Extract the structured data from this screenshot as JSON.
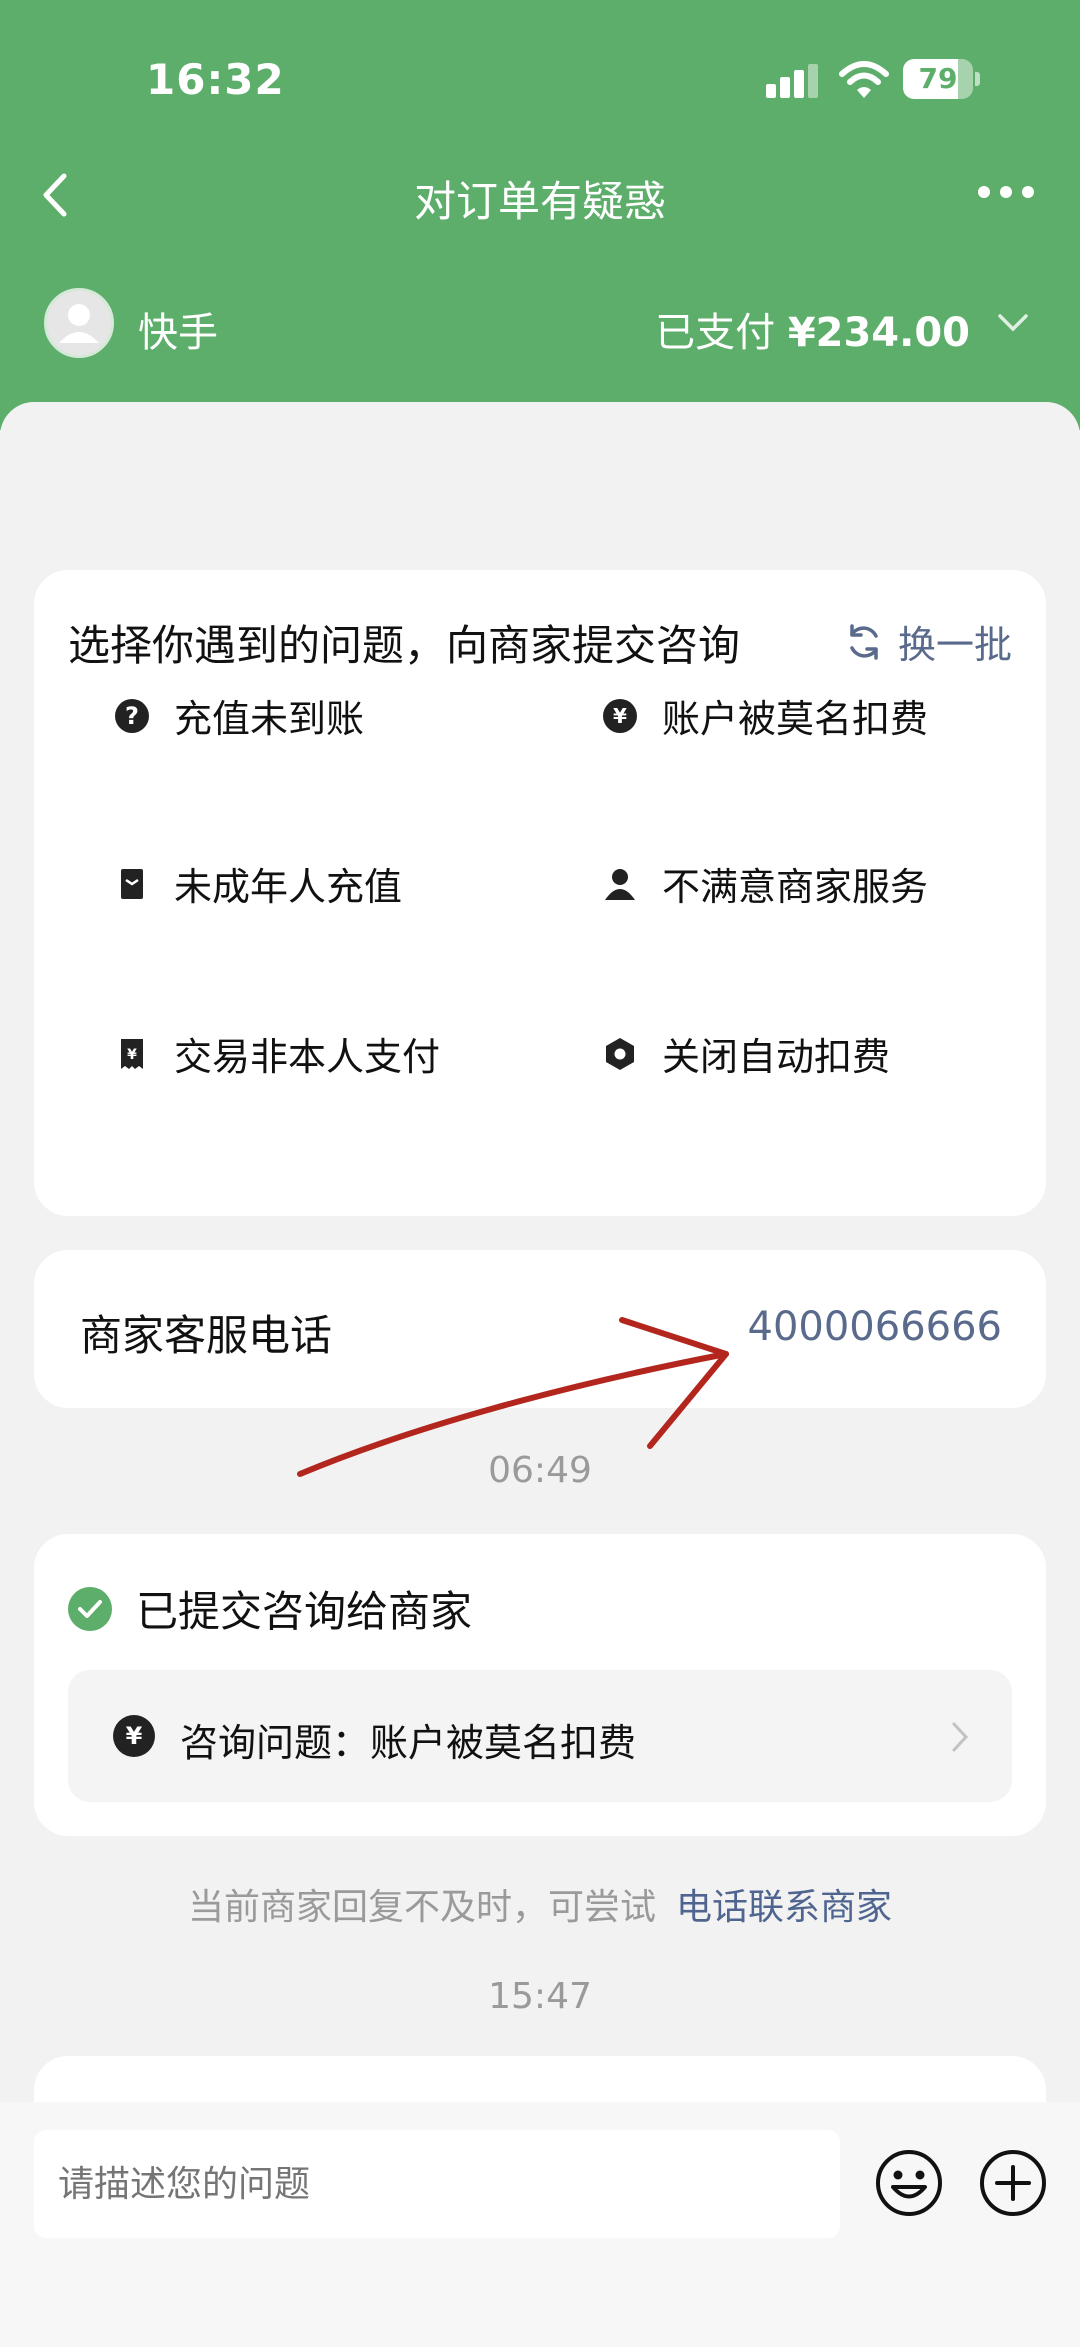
{
  "status": {
    "time": "16:32",
    "battery": "79",
    "battery_level": 0.79
  },
  "nav": {
    "title": "对订单有疑惑"
  },
  "shop": {
    "name": "快手",
    "paid_label": "已支付",
    "amount": "¥234.00"
  },
  "questions": {
    "title": "选择你遇到的问题，向商家提交咨询",
    "refresh_label": "换一批",
    "items": [
      {
        "label": "充值未到账",
        "icon": "question-circle-icon"
      },
      {
        "label": "账户被莫名扣费",
        "icon": "yen-circle-icon"
      },
      {
        "label": "未成年人充值",
        "icon": "id-card-icon"
      },
      {
        "label": "不满意商家服务",
        "icon": "person-icon"
      },
      {
        "label": "交易非本人支付",
        "icon": "receipt-icon"
      },
      {
        "label": "关闭自动扣费",
        "icon": "hexagon-icon"
      }
    ]
  },
  "phone": {
    "label": "商家客服电话",
    "number": "4000066666"
  },
  "timestamps": {
    "first": "06:49",
    "second": "15:47"
  },
  "submitted": {
    "title": "已提交咨询给商家",
    "question_text": "咨询问题：账户被莫名扣费"
  },
  "hint": {
    "text": "当前商家回复不及时，可尝试",
    "link": "电话联系商家"
  },
  "input": {
    "placeholder": "请描述您的问题"
  },
  "colors": {
    "header": "#5eae6b",
    "accent_link": "#5a6a8c",
    "check_green": "#5eae6b"
  }
}
